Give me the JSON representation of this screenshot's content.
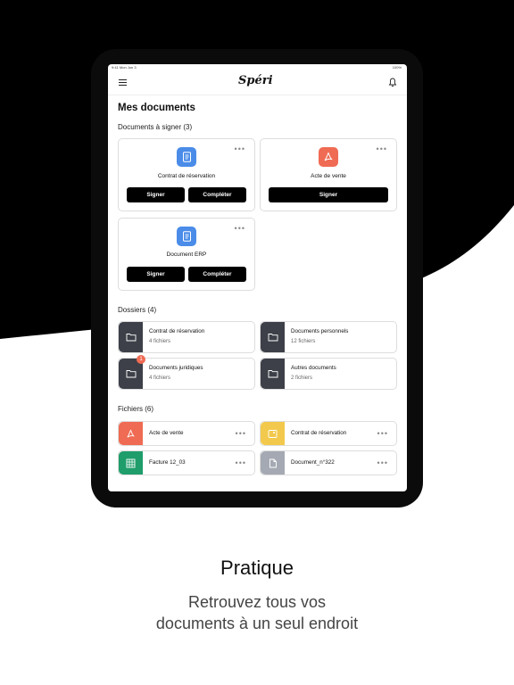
{
  "status_bar": {
    "time": "9:41 Mon Jun 3",
    "battery": "100%"
  },
  "app": {
    "logo": "Spéri"
  },
  "page": {
    "title": "Mes documents"
  },
  "sign_section": {
    "title": "Documents à signer (3)",
    "cards": [
      {
        "name": "Contrat de réservation",
        "icon": "document-icon",
        "color": "#4a8ce8",
        "buttons": [
          "Signer",
          "Compléter"
        ]
      },
      {
        "name": "Acte de vente",
        "icon": "pdf-icon",
        "color": "#ef6b53",
        "buttons": [
          "Signer"
        ]
      },
      {
        "name": "Document ERP",
        "icon": "document-icon",
        "color": "#4a8ce8",
        "buttons": [
          "Signer",
          "Compléter"
        ]
      }
    ]
  },
  "folders_section": {
    "title": "Dossiers (4)",
    "items": [
      {
        "name": "Contrat de réservation",
        "count": "4 fichiers",
        "badge": ""
      },
      {
        "name": "Documents personnels",
        "count": "12 fichiers",
        "badge": ""
      },
      {
        "name": "Documents juridiques",
        "count": "4 fichiers",
        "badge": "1"
      },
      {
        "name": "Autres documents",
        "count": "2 fichiers",
        "badge": ""
      }
    ]
  },
  "files_section": {
    "title": "Fichiers (6)",
    "items": [
      {
        "name": "Acte de vente",
        "icon": "pdf-icon",
        "color": "#ef6b53"
      },
      {
        "name": "Contrat de réservation",
        "icon": "image-file-icon",
        "color": "#f2c94c"
      },
      {
        "name": "Facture 12_03",
        "icon": "spreadsheet-icon",
        "color": "#1f9d6b"
      },
      {
        "name": "Document_n°322",
        "icon": "file-icon",
        "color": "#a4a9b3"
      }
    ]
  },
  "marketing": {
    "headline": "Pratique",
    "line1": "Retrouvez tous vos",
    "line2": "documents à un seul endroit"
  },
  "colors": {
    "folder": "#3d4048",
    "accent_badge": "#ef6b53",
    "background_shape": "#000000"
  }
}
